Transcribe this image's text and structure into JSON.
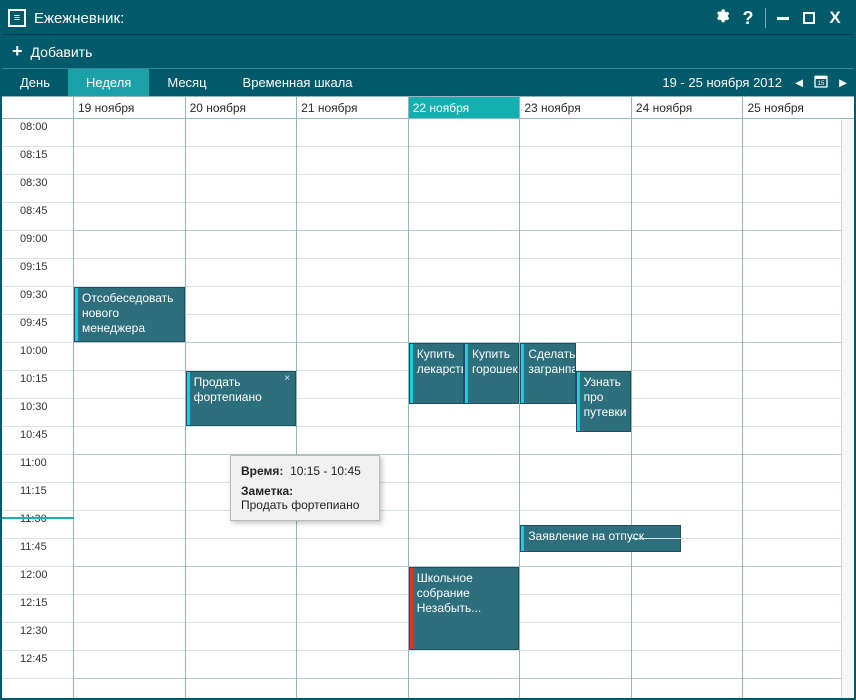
{
  "window": {
    "title": "Ежежневник:"
  },
  "addbar": {
    "label": "Добавить"
  },
  "views": {
    "day": "День",
    "week": "Неделя",
    "month": "Месяц",
    "timeline": "Временная шкала",
    "active": "week"
  },
  "dateRange": "19  - 25 ноября 2012",
  "days": [
    {
      "label": "19 ноября",
      "today": false
    },
    {
      "label": "20 ноября",
      "today": false
    },
    {
      "label": "21 ноября",
      "today": false
    },
    {
      "label": "22 ноября",
      "today": true
    },
    {
      "label": "23 ноября",
      "today": false
    },
    {
      "label": "24 ноября",
      "today": false
    },
    {
      "label": "25 ноября",
      "today": false
    }
  ],
  "timeSlots": [
    "08:00",
    "08:15",
    "08:30",
    "08:45",
    "09:00",
    "09:15",
    "09:30",
    "09:45",
    "10:00",
    "10:15",
    "10:30",
    "10:45",
    "11:00",
    "11:15",
    "11:30",
    "11:45",
    "12:00",
    "12:15",
    "12:30",
    "12:45"
  ],
  "events": {
    "e1": {
      "title": "Отсобеседовать нового менеджера",
      "day": 0,
      "startSlot": 6,
      "span": 2,
      "half": ""
    },
    "e2": {
      "title": "Продать фортепиано",
      "day": 1,
      "startSlot": 9,
      "span": 2,
      "half": "",
      "hasClose": true
    },
    "e3": {
      "title": "Купить лекарство",
      "day": 3,
      "startSlot": 8,
      "span": 2.2,
      "half": "left"
    },
    "e4": {
      "title": "Купить горошек",
      "day": 3,
      "startSlot": 8,
      "span": 2.2,
      "half": "right"
    },
    "e5": {
      "title": "Школьное собрание Незабыть...",
      "day": 3,
      "startSlot": 16,
      "span": 3,
      "half": "",
      "red": true
    },
    "e6": {
      "title": "Сделать загранпаспорт",
      "day": 4,
      "startSlot": 8,
      "span": 2.2,
      "half": "left"
    },
    "e7": {
      "title": "Узнать про путевки",
      "day": 4,
      "startSlot": 9,
      "span": 2.2,
      "half": "right"
    },
    "e8": {
      "title": "Заявление на отпуск",
      "day": 4,
      "startSlot": 14.5,
      "span": 1,
      "half": "",
      "wide": true
    }
  },
  "tooltip": {
    "timeLabel": "Время:",
    "timeValue": "10:15 - 10:45",
    "noteLabel": "Заметка:",
    "noteValue": "Продать фортепиано"
  },
  "nowSlot": 14.2,
  "colors": {
    "accent": "#14b0b0",
    "window": "#005a6a",
    "event": "#2e6f7e"
  }
}
